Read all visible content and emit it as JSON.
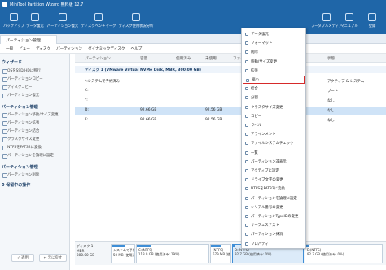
{
  "window": {
    "title": "MiniTool Partition Wizard 無料版 12.7"
  },
  "toolbar": {
    "items": [
      "バックアップ",
      "データ復元",
      "パーティション復元",
      "ディスクベンチマーク",
      "ディスク使用状況分析",
      "ブータブルメディア",
      "マニュアル",
      "登録"
    ]
  },
  "tabs": {
    "active": "パーティション管理"
  },
  "menu": {
    "items": [
      "一般",
      "ビュー",
      "ディスク",
      "パーティション",
      "ダイナミックディスク",
      "ヘルプ"
    ]
  },
  "sidebar": {
    "sections": [
      {
        "title": "ウィザード",
        "items": [
          "OSをSSD/HDに移行",
          "パーティションコピー",
          "ディスクコピー",
          "パーティション復元"
        ]
      },
      {
        "title": "パーティション管理",
        "items": [
          "パーティション移動/サイズ変更",
          "パーティション拡張",
          "パーティション結合",
          "クラスタサイズ変更",
          "NTFSをFAT32に変換",
          "パーティションを論理に設定"
        ]
      },
      {
        "title": "パーティション管理",
        "items": [
          "パーティション削除"
        ]
      },
      {
        "title": "0 保留中の操作",
        "items": []
      }
    ],
    "apply_label": "✓ 適用",
    "undo_label": "← 元に戻す"
  },
  "table": {
    "headers": [
      "パーティション",
      "容量",
      "使用済み",
      "未使用",
      "ファイル",
      "状態"
    ],
    "disk_row": "ディスク 1 (VMware Virtual NVMe Disk, MBR, 300.00 GB)",
    "rows": [
      {
        "name": "*:システムで予約済み",
        "cap": "",
        "used": "",
        "free": "",
        "status": "アクティブ & システム"
      },
      {
        "name": "C:",
        "cap": "",
        "used": "",
        "free": "",
        "status": "ブート"
      },
      {
        "name": "*:",
        "cap": "",
        "used": "",
        "free": "",
        "status": "なし"
      },
      {
        "name": "D:",
        "cap": "92.66 GB",
        "used": "",
        "free": "92.56 GB",
        "status": "なし"
      },
      {
        "name": "E:",
        "cap": "92.66 GB",
        "used": "",
        "free": "92.56 GB",
        "status": "なし"
      }
    ]
  },
  "diskmap": {
    "disk_label": "ディスク 1",
    "disk_type": "MBR",
    "disk_size": "300.00 GB",
    "partitions": [
      {
        "label": "システムで予約",
        "info": "50 MB (使用済:",
        "fill": 0.6
      },
      {
        "label": "C:(NTFS)",
        "info": "113.9 GB (使用済み: 19%)",
        "fill": 0.19
      },
      {
        "label": "(NTFS)",
        "info": "579 MB (使",
        "fill": 0.5
      },
      {
        "label": "D:(NTFS)",
        "info": "92.7 GB (使用済み: 0%)",
        "fill": 0.0
      },
      {
        "label": "E:(NTFS)",
        "info": "92.7 GB (使用済み: 0%)",
        "fill": 0.0
      }
    ]
  },
  "context_menu": {
    "items": [
      "データ復元",
      "フォーマット",
      "削除",
      "移動/サイズ変更",
      "拡張",
      "縮小",
      "結合",
      "分割",
      "クラスタサイズ変更",
      "コピー",
      "ラベル",
      "アラインメント",
      "ファイルシステムチェック",
      "一覧",
      "パーティション非表示",
      "アクティブに設定",
      "ドライブ文字の変更",
      "NTFSをFAT32に変換",
      "パーティションを論理に設定",
      "シリアル番号の変更",
      "パーティションTypeIDの変更",
      "サーフェステスト",
      "パーティション抹消",
      "プロパティ"
    ],
    "highlighted": "縮小"
  }
}
